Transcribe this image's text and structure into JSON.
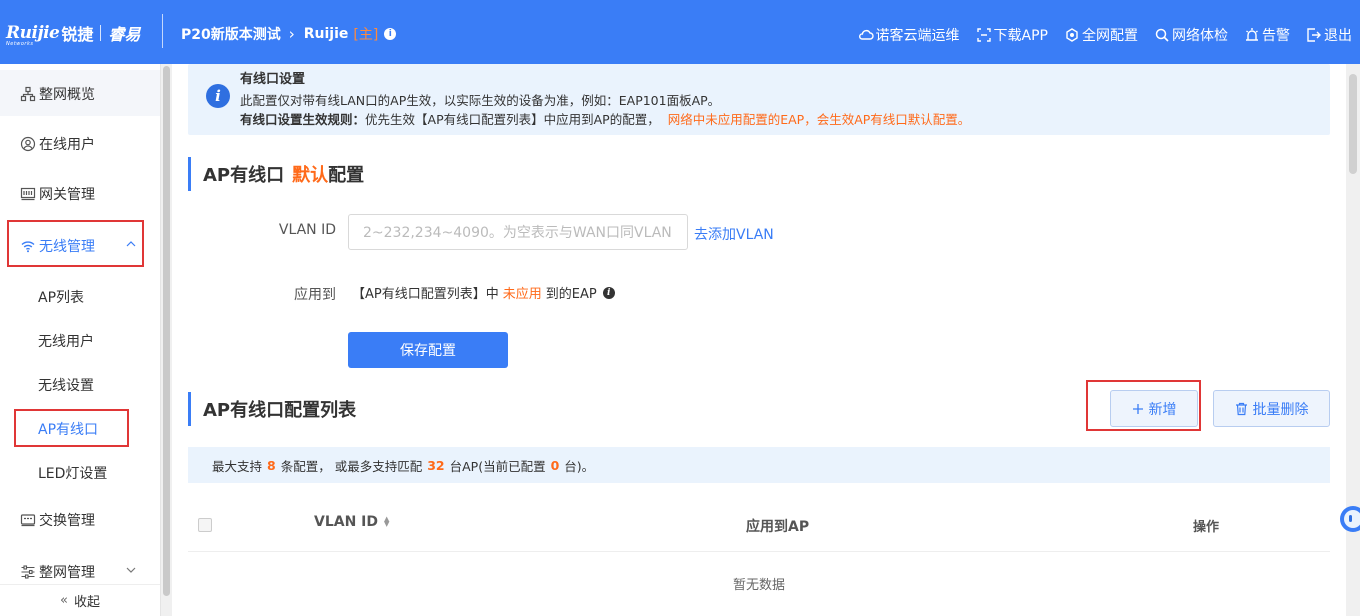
{
  "header": {
    "logo": {
      "mark": "Ruijie",
      "sub": "Networks",
      "brand_cn": "锐捷",
      "brand_cn2": "睿易"
    },
    "breadcrumb": {
      "project": "P20新版本测试",
      "device": "Ruijie",
      "role": "[主]"
    },
    "nav": [
      {
        "label": "诺客云端运维",
        "icon": "cloud-icon"
      },
      {
        "label": "下载APP",
        "icon": "download-app-icon"
      },
      {
        "label": "全网配置",
        "icon": "network-config-icon"
      },
      {
        "label": "网络体检",
        "icon": "network-check-icon"
      },
      {
        "label": "告警",
        "icon": "alarm-icon"
      },
      {
        "label": "退出",
        "icon": "logout-icon"
      }
    ]
  },
  "sidebar": {
    "items": [
      {
        "label": "整网概览",
        "icon": "topology-icon"
      },
      {
        "label": "在线用户",
        "icon": "user-icon"
      },
      {
        "label": "网关管理",
        "icon": "gateway-icon"
      },
      {
        "label": "无线管理",
        "icon": "wifi-icon"
      },
      {
        "label": "交换管理",
        "icon": "switch-icon"
      },
      {
        "label": "整网管理",
        "icon": "settings-sliders-icon"
      }
    ],
    "wireless_subitems": [
      {
        "label": "AP列表"
      },
      {
        "label": "无线用户"
      },
      {
        "label": "无线设置"
      },
      {
        "label": "AP有线口"
      },
      {
        "label": "LED灯设置"
      }
    ],
    "collapse_label": "收起"
  },
  "notice": {
    "title": "有线口设置",
    "line1": "此配置仅对带有线LAN口的AP生效，以实际生效的设备为准，例如：EAP101面板AP。",
    "rule_label": "有线口设置生效规则：",
    "rule_text": "优先生效【AP有线口配置列表】中应用到AP的配置，",
    "rule_warn": "网络中未应用配置的EAP，会生效AP有线口默认配置。"
  },
  "default_config": {
    "title_prefix": "AP有线口",
    "title_highlight": "默认",
    "title_suffix": "配置",
    "vlan_label": "VLAN ID",
    "vlan_placeholder": "2~232,234~4090。为空表示与WAN口同VLAN",
    "add_vlan_link": "去添加VLAN",
    "apply_label": "应用到",
    "apply_prefix": "【AP有线口配置列表】中",
    "apply_highlight": "未应用",
    "apply_suffix": "到的EAP",
    "save_button": "保存配置"
  },
  "config_list": {
    "title": "AP有线口配置列表",
    "add_button": "新增",
    "batch_delete_button": "批量删除",
    "tip_prefix": "最大支持",
    "max_rules": "8",
    "tip_mid1": "条配置，  或最多支持匹配",
    "max_aps": "32",
    "tip_mid2": "台AP(当前已配置",
    "configured": "0",
    "tip_suffix": "台)。",
    "columns": [
      "VLAN ID",
      "应用到AP",
      "操作"
    ],
    "empty_text": "暂无数据"
  },
  "colors": {
    "primary": "#3a7df6",
    "warning": "#ff6a1a",
    "highlight_border": "#e03636"
  }
}
